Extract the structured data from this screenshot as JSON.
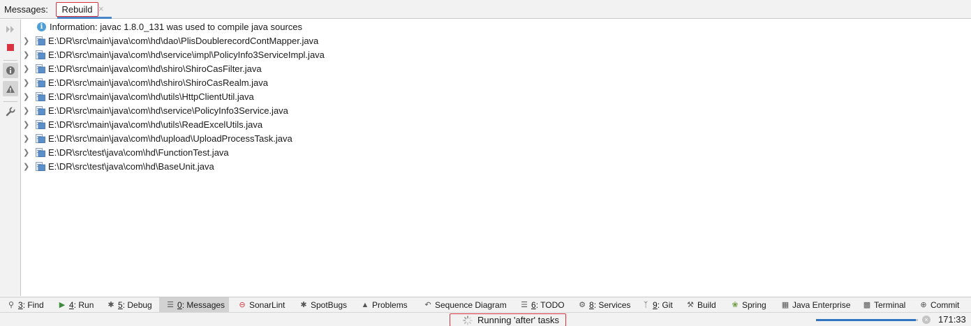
{
  "header": {
    "label": "Messages:",
    "tab_label": "Rebuild",
    "tab_close": "×"
  },
  "toolbar": {
    "icons": [
      "rerun-icon",
      "stop-icon",
      "info-filter-icon",
      "warning-filter-icon",
      "settings-wrench-icon"
    ]
  },
  "messages": {
    "info": "Information: javac 1.8.0_131 was used to compile java sources",
    "files": [
      "E:\\DR\\src\\main\\java\\com\\hd\\dao\\PlisDoublerecordContMapper.java",
      "E:\\DR\\src\\main\\java\\com\\hd\\service\\impl\\PolicyInfo3ServiceImpl.java",
      "E:\\DR\\src\\main\\java\\com\\hd\\shiro\\ShiroCasFilter.java",
      "E:\\DR\\src\\main\\java\\com\\hd\\shiro\\ShiroCasRealm.java",
      "E:\\DR\\src\\main\\java\\com\\hd\\utils\\HttpClientUtil.java",
      "E:\\DR\\src\\main\\java\\com\\hd\\service\\PolicyInfo3Service.java",
      "E:\\DR\\src\\main\\java\\com\\hd\\utils\\ReadExcelUtils.java",
      "E:\\DR\\src\\main\\java\\com\\hd\\upload\\UploadProcessTask.java",
      "E:\\DR\\src\\test\\java\\com\\hd\\FunctionTest.java",
      "E:\\DR\\src\\test\\java\\com\\hd\\BaseUnit.java"
    ]
  },
  "toolwindows": {
    "find": {
      "key": "3",
      "label": ": Find"
    },
    "run": {
      "key": "4",
      "label": ": Run"
    },
    "debug": {
      "key": "5",
      "label": ": Debug"
    },
    "messages": {
      "key": "0",
      "label": ": Messages"
    },
    "sonarlint": {
      "label": "SonarLint"
    },
    "spotbugs": {
      "label": "SpotBugs"
    },
    "problems": {
      "label": "Problems"
    },
    "sequence": {
      "label": "Sequence Diagram"
    },
    "todo": {
      "key": "6",
      "label": ": TODO"
    },
    "services": {
      "key": "8",
      "label": ": Services"
    },
    "git": {
      "key": "9",
      "label": ": Git"
    },
    "build": {
      "label": "Build"
    },
    "spring": {
      "label": "Spring"
    },
    "java_enterprise": {
      "label": "Java Enterprise"
    },
    "terminal": {
      "label": "Terminal"
    },
    "commit": {
      "label": "Commit"
    }
  },
  "status": {
    "task_text": "Running 'after' tasks",
    "progress": 0.98,
    "cancel": "×",
    "caret": "171:33"
  },
  "colors": {
    "highlight_border": "#d9333f",
    "accent": "#4a86c7",
    "progress": "#2f74c0"
  }
}
